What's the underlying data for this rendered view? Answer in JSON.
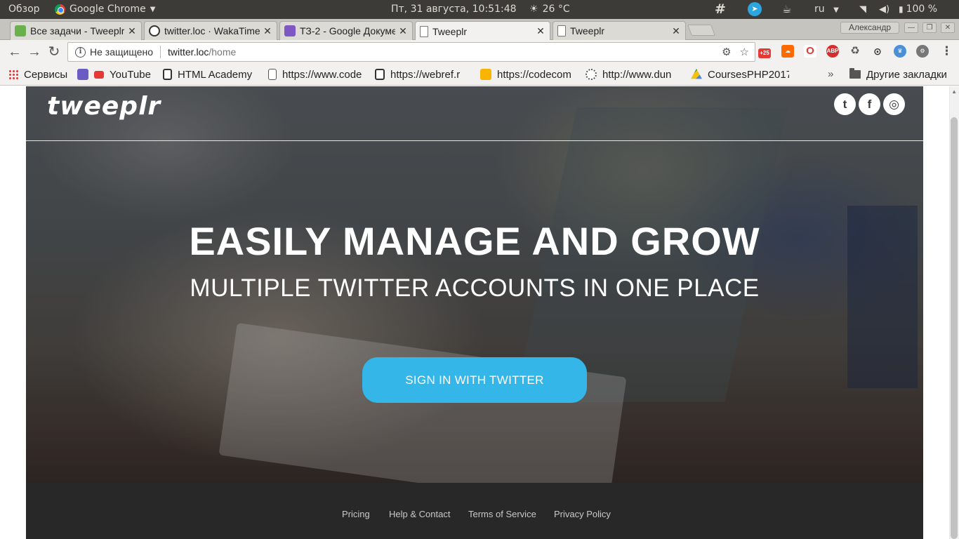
{
  "os_panel": {
    "overview": "Обзор",
    "app_name": "Google Chrome",
    "clock": "Пт, 31 августа, 10:51:48",
    "weather": "26 °C",
    "language": "ru",
    "battery": "100 %"
  },
  "tabs": [
    {
      "title": "Все задачи - Tweeplr",
      "active": false
    },
    {
      "title": "twitter.loc · WakaTime",
      "active": false
    },
    {
      "title": "ТЗ-2 - Google Документы",
      "active": false
    },
    {
      "title": "Tweeplr",
      "active": true
    },
    {
      "title": "Tweeplr",
      "active": false
    }
  ],
  "profile_name": "Александр",
  "toolbar": {
    "security_label": "Не защищено",
    "url_host": "twitter.loc",
    "url_path": "/home",
    "ext_badge": "+25"
  },
  "bookmarks": {
    "items": [
      {
        "label": "Сервисы"
      },
      {
        "label": "YouTube"
      },
      {
        "label": "HTML Academy"
      },
      {
        "label": "https://www.code"
      },
      {
        "label": "https://webref.r"
      },
      {
        "label": "https://codecom"
      },
      {
        "label": "http://www.dun"
      },
      {
        "label": "CoursesPHP2017"
      }
    ],
    "overflow": "»",
    "other_folder": "Другие закладки"
  },
  "page": {
    "logo": "tweeplr",
    "social": {
      "twitter": "t",
      "facebook": "f",
      "instagram": "◎"
    },
    "headline": "EASILY MANAGE AND GROW",
    "subline": "MULTIPLE TWITTER ACCOUNTS IN ONE PLACE",
    "cta_label": "SIGN IN WITH TWITTER",
    "cta_color": "#34b6e8",
    "footer_links": [
      "Pricing",
      "Help & Contact",
      "Terms of Service",
      "Privacy Policy"
    ]
  }
}
